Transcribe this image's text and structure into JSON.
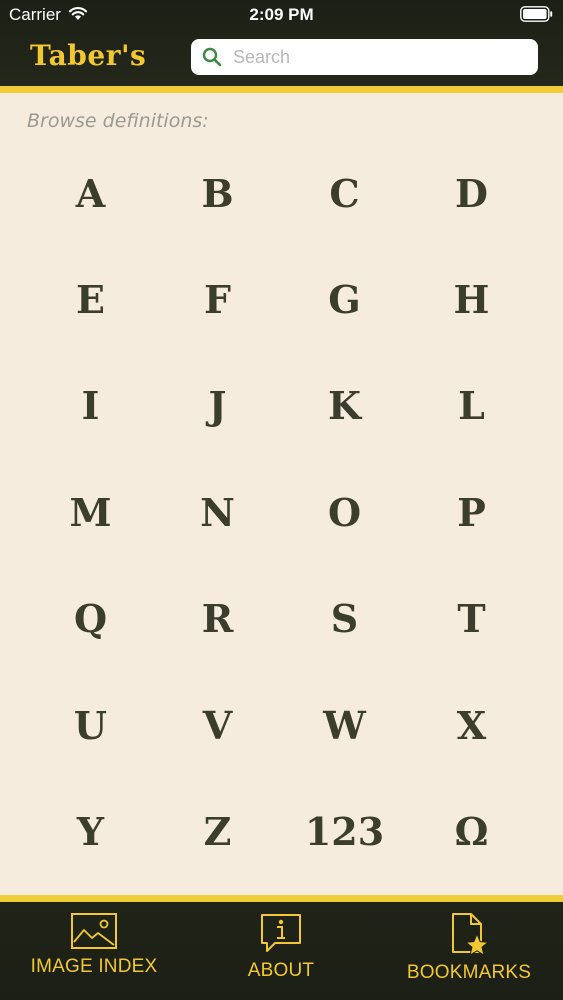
{
  "status_bar": {
    "carrier": "Carrier",
    "time": "2:09 PM"
  },
  "header": {
    "logo": "Taber's",
    "search_placeholder": "Search"
  },
  "browse": {
    "label": "Browse definitions:",
    "letters": [
      "A",
      "B",
      "C",
      "D",
      "E",
      "F",
      "G",
      "H",
      "I",
      "J",
      "K",
      "L",
      "M",
      "N",
      "O",
      "P",
      "Q",
      "R",
      "S",
      "T",
      "U",
      "V",
      "W",
      "X",
      "Y",
      "Z",
      "123",
      "Ω"
    ]
  },
  "tabs": [
    {
      "label": "IMAGE INDEX",
      "icon": "image-icon"
    },
    {
      "label": "ABOUT",
      "icon": "info-icon"
    },
    {
      "label": "BOOKMARKS",
      "icon": "bookmark-star-icon"
    }
  ],
  "colors": {
    "background": "#f6ecdd",
    "header": "#1c1f15",
    "accent_gold": "#f2cd3a",
    "letter": "#3b3e2c",
    "search_icon": "#3f8a43"
  }
}
